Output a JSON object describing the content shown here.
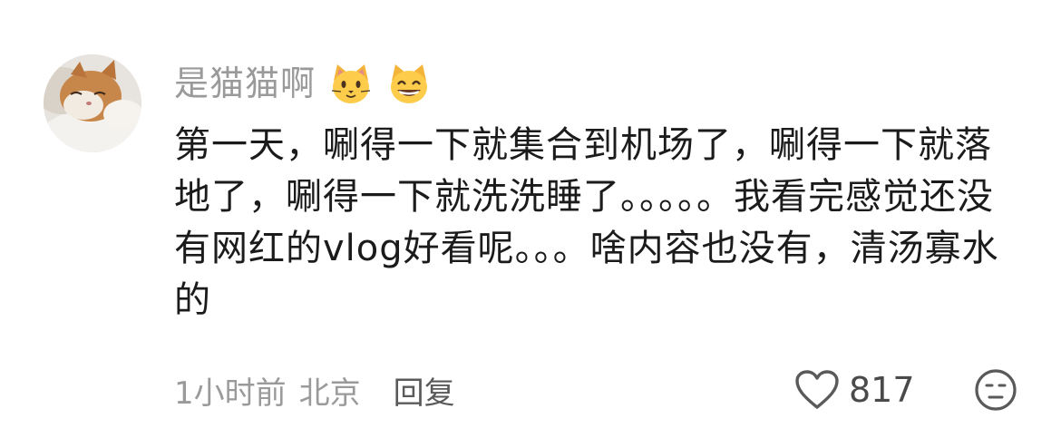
{
  "comment": {
    "username": "是猫猫啊",
    "username_emojis": [
      "cat-face-emoji",
      "grinning-cat-emoji"
    ],
    "text": "第一天，唰得一下就集合到机场了，唰得一下就落地了，唰得一下就洗洗睡了。。。。。我看完感觉还没有网红的vlog好看呢。。。啥内容也没有，清汤寡水的",
    "time": "1小时前",
    "location": "北京",
    "reply_label": "回复",
    "like_count": "817",
    "icons": {
      "like": "heart-outline-icon",
      "dislike": "unamused-face-icon"
    },
    "colors": {
      "text": "#1b1b1b",
      "meta": "#9a9a9a",
      "reply": "#5a5a5a"
    }
  }
}
